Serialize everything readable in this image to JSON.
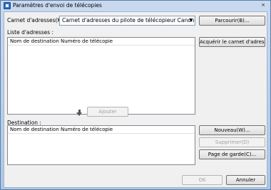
{
  "window": {
    "title": "Paramètres d'envoi de télécopies",
    "close_glyph": "×"
  },
  "address_book": {
    "label": "Carnet d'adresses(K) :",
    "selected": "Carnet d'adresses du pilote de télécopieur Canon",
    "browse_label": "Parcourir(B)..."
  },
  "address_list": {
    "label": "Liste d'adresses :",
    "header": "Nom de destination Numéro de télécopie",
    "get_book_label": "Acquérir le carnet d'adresses"
  },
  "add": {
    "label": "Ajouter"
  },
  "destination": {
    "label": "Destination :",
    "header": "Nom de destination Numéro de télécopie",
    "new_label": "Nouveau(W)...",
    "delete_label": "Supprimer(D)",
    "cover_label": "Page de garde(C)..."
  },
  "footer": {
    "ok_label": "OK",
    "cancel_label": "Annuler"
  }
}
